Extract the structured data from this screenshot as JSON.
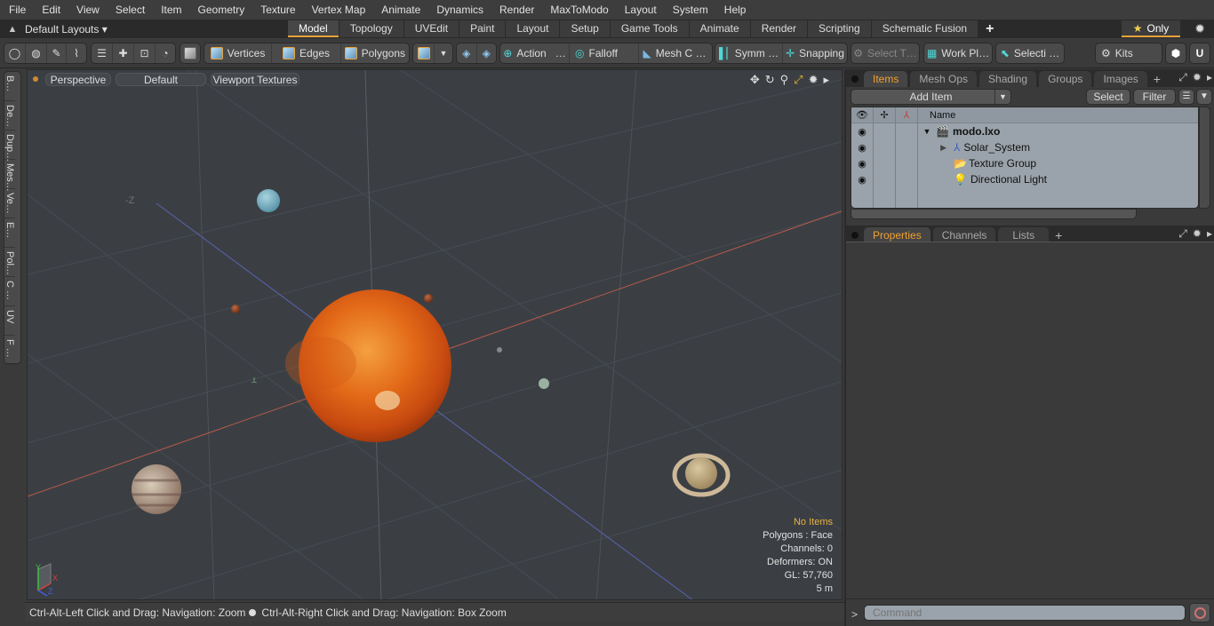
{
  "menu": [
    "File",
    "Edit",
    "View",
    "Select",
    "Item",
    "Geometry",
    "Texture",
    "Vertex Map",
    "Animate",
    "Dynamics",
    "Render",
    "MaxToModo",
    "Layout",
    "System",
    "Help"
  ],
  "layoutbar": {
    "layouts_label": "Default Layouts ▾",
    "tabs": [
      "Model",
      "Topology",
      "UVEdit",
      "Paint",
      "Layout",
      "Setup",
      "Game Tools",
      "Animate",
      "Render",
      "Scripting",
      "Schematic Fusion"
    ],
    "active_tab": "Model",
    "add_tab": "+",
    "only_label": "Only",
    "accent": "#e8a33c"
  },
  "toolbar": {
    "vertices": "Vertices",
    "edges": "Edges",
    "polygons": "Polygons",
    "action": "Action",
    "action_more": "…",
    "falloff": "Falloff",
    "mesh_c": "Mesh C …",
    "symm": "Symm …",
    "snapping": "Snapping",
    "select_t": "Select T…",
    "work_pl": "Work Pl…",
    "selecti": "Selecti …",
    "kits": "Kits"
  },
  "left_tabs": [
    "B…",
    "De…",
    "Dup…",
    "Mes…",
    "Ve…",
    "E…",
    "Pol…",
    "C …",
    "UV",
    "F …"
  ],
  "viewport": {
    "view_mode": "Perspective",
    "shading": "Default",
    "textures": "Viewport Textures",
    "axis_label": "-Z",
    "hud": {
      "selection": "No Items",
      "polygons": "Polygons : Face",
      "channels": "Channels: 0",
      "deformers": "Deformers: ON",
      "gl": "GL: 57,760",
      "scale": "5 m"
    },
    "gizmo": {
      "x": "X",
      "y": "Y",
      "z": "Z"
    }
  },
  "status": {
    "hint1": "Ctrl-Alt-Left Click and Drag: Navigation: Zoom",
    "hint2": "Ctrl-Alt-Right Click and Drag: Navigation: Box Zoom"
  },
  "items_panel": {
    "tabs": [
      "Items",
      "Mesh Ops",
      "Shading",
      "Groups",
      "Images"
    ],
    "active_tab": "Items",
    "add_item": "Add Item",
    "select": "Select",
    "filter": "Filter",
    "column_name": "Name",
    "rows": [
      {
        "name": "modo.lxo",
        "icon": "scene-icon",
        "expander": "▼",
        "bold": true
      },
      {
        "name": "Solar_System",
        "icon": "locator-icon",
        "expander": "▶",
        "bold": false
      },
      {
        "name": "Texture Group",
        "icon": "folder-icon",
        "expander": "",
        "bold": false
      },
      {
        "name": "Directional Light",
        "icon": "light-icon",
        "expander": "",
        "bold": false
      }
    ]
  },
  "properties_panel": {
    "tabs": [
      "Properties",
      "Channels",
      "Lists"
    ],
    "active_tab": "Properties"
  },
  "command": {
    "prompt": ">",
    "placeholder": "Command"
  }
}
